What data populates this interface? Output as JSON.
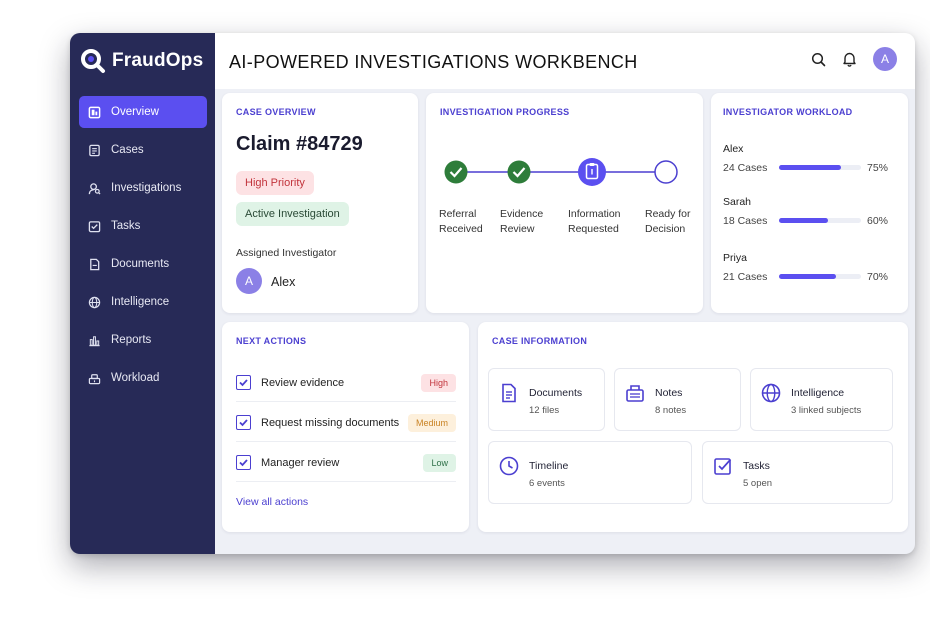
{
  "app": {
    "name": "FraudOps",
    "title": "AI-POWERED INVESTIGATIONS WORKBENCH",
    "user_initial": "A"
  },
  "colors": {
    "sidebar": "#272a57",
    "accent": "#5b4ff0",
    "accent_text": "#4b3fd0",
    "done": "#2e7d3a"
  },
  "sidebar": {
    "items": [
      {
        "label": "Overview",
        "icon": "overview-icon",
        "active": true
      },
      {
        "label": "Cases",
        "icon": "cases-icon",
        "active": false
      },
      {
        "label": "Investigations",
        "icon": "investigations-icon",
        "active": false
      },
      {
        "label": "Tasks",
        "icon": "tasks-icon",
        "active": false
      },
      {
        "label": "Documents",
        "icon": "documents-icon",
        "active": false
      },
      {
        "label": "Intelligence",
        "icon": "globe-icon",
        "active": false
      },
      {
        "label": "Reports",
        "icon": "reports-icon",
        "active": false
      },
      {
        "label": "Workload",
        "icon": "workload-icon",
        "active": false
      }
    ]
  },
  "case_overview": {
    "title": "CASE OVERVIEW",
    "claim": "Claim #84729",
    "priority": "High Priority",
    "status": "Active Investigation",
    "assigned_label": "Assigned Investigator",
    "investigator_initial": "A",
    "investigator_name": "Alex"
  },
  "progress": {
    "title": "INVESTIGATION PROGRESS",
    "steps": [
      {
        "line1": "Referral",
        "line2": "Received",
        "state": "done"
      },
      {
        "line1": "Evidence",
        "line2": "Review",
        "state": "done"
      },
      {
        "line1": "Information",
        "line2": "Requested",
        "state": "current"
      },
      {
        "line1": "Ready for",
        "line2": "Decision",
        "state": "pending"
      }
    ]
  },
  "workload": {
    "title": "INVESTIGATOR WORKLOAD",
    "rows": [
      {
        "name": "Alex",
        "cases": "24 Cases",
        "pct": "75%",
        "fraction": 0.75
      },
      {
        "name": "Sarah",
        "cases": "18 Cases",
        "pct": "60%",
        "fraction": 0.6
      },
      {
        "name": "Priya",
        "cases": "21 Cases",
        "pct": "70%",
        "fraction": 0.7
      }
    ]
  },
  "next_actions": {
    "title": "NEXT ACTIONS",
    "items": [
      {
        "label": "Review evidence",
        "priority": "High"
      },
      {
        "label": "Request missing documents",
        "priority": "Medium"
      },
      {
        "label": "Manager review",
        "priority": "Low"
      }
    ],
    "view_all": "View all actions"
  },
  "case_info": {
    "title": "CASE INFORMATION",
    "tiles": [
      {
        "title": "Documents",
        "sub": "12 files",
        "icon": "document-icon"
      },
      {
        "title": "Notes",
        "sub": "8 notes",
        "icon": "notes-icon"
      },
      {
        "title": "Intelligence",
        "sub": "3 linked subjects",
        "icon": "globe-icon"
      },
      {
        "title": "Timeline",
        "sub": "6 events",
        "icon": "clock-icon"
      },
      {
        "title": "Tasks",
        "sub": "5 open",
        "icon": "checkbox-icon"
      }
    ]
  }
}
